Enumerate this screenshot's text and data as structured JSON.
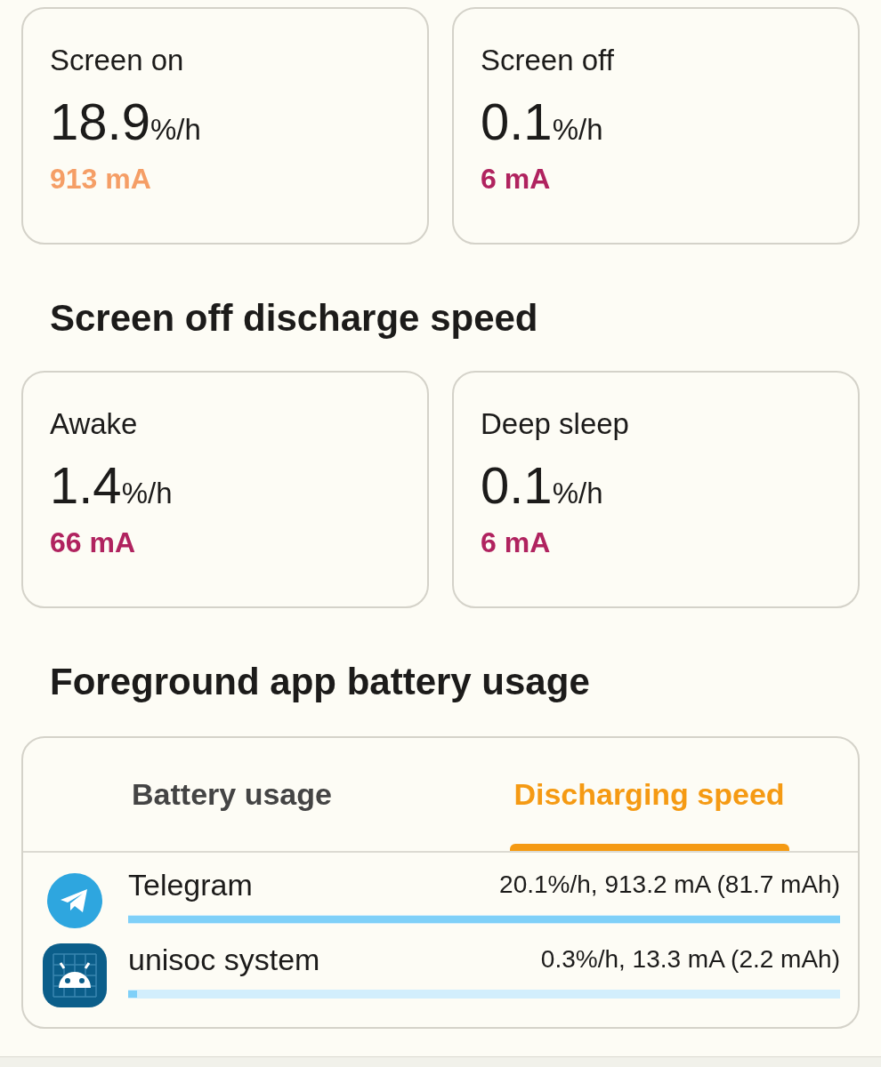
{
  "screen_stats": [
    {
      "label": "Screen on",
      "value": "18.9",
      "unit": "%/h",
      "current": "913 mA",
      "color": "#f59e66"
    },
    {
      "label": "Screen off",
      "value": "0.1",
      "unit": "%/h",
      "current": "6 mA",
      "color": "#b0235f"
    }
  ],
  "screen_off_section": {
    "title": "Screen off discharge speed",
    "stats": [
      {
        "label": "Awake",
        "value": "1.4",
        "unit": "%/h",
        "current": "66 mA",
        "color": "#b0235f"
      },
      {
        "label": "Deep sleep",
        "value": "0.1",
        "unit": "%/h",
        "current": "6 mA",
        "color": "#b0235f"
      }
    ]
  },
  "foreground_section": {
    "title": "Foreground app battery usage",
    "tabs": [
      {
        "label": "Battery usage",
        "selected": false
      },
      {
        "label": "Discharging speed",
        "selected": true
      }
    ],
    "apps": [
      {
        "kind": "telegram",
        "name": "Telegram",
        "stats": "20.1%/h, 913.2 mA (81.7 mAh)",
        "level": 1.0
      },
      {
        "kind": "android",
        "name": "unisoc system",
        "stats": "0.3%/h, 13.3 mA (2.2 mAh)",
        "level": 0.013
      }
    ]
  }
}
